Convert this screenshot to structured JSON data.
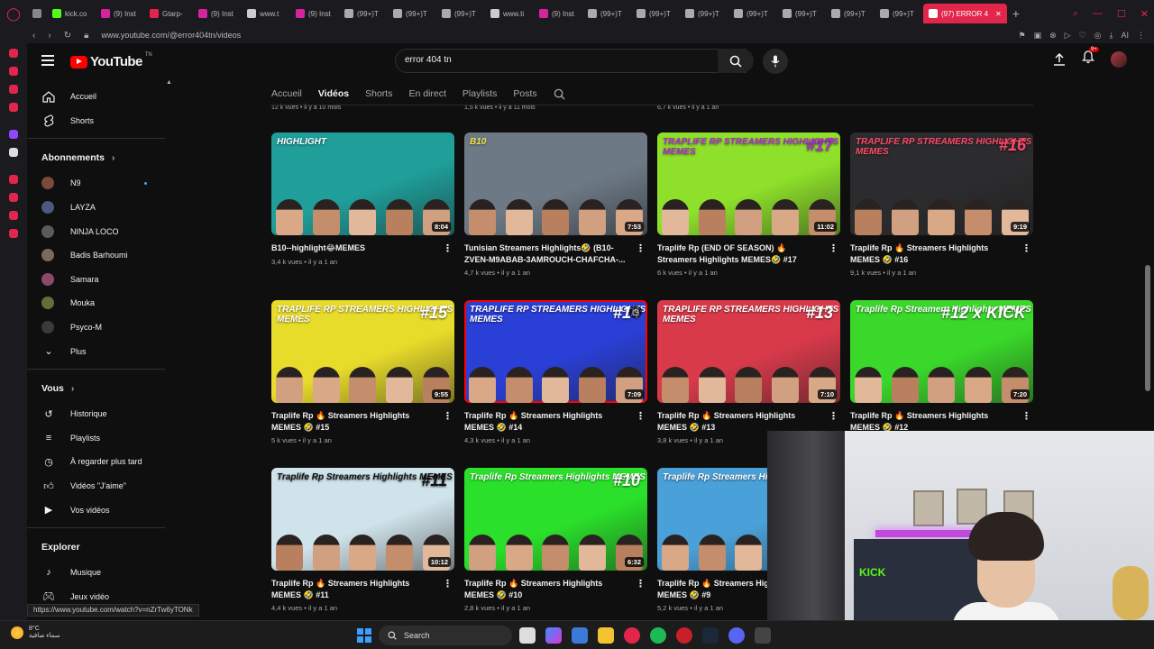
{
  "browser": {
    "tabs": [
      {
        "label": "",
        "color": "#888888"
      },
      {
        "label": "kick.co",
        "color": "#53fc18"
      },
      {
        "label": "(9) Inst",
        "color": "#d6249f"
      },
      {
        "label": "Gtarp-",
        "color": "#e2264b"
      },
      {
        "label": "(9) Inst",
        "color": "#d6249f"
      },
      {
        "label": "www.t",
        "color": "#cccccc"
      },
      {
        "label": "(9) Inst",
        "color": "#d6249f"
      },
      {
        "label": "(99+)T",
        "color": "#aaaaaa"
      },
      {
        "label": "(99+)T",
        "color": "#aaaaaa"
      },
      {
        "label": "(99+)T",
        "color": "#aaaaaa"
      },
      {
        "label": "www.ti",
        "color": "#cccccc"
      },
      {
        "label": "(9) Inst",
        "color": "#d6249f"
      },
      {
        "label": "(99+)T",
        "color": "#aaaaaa"
      },
      {
        "label": "(99+)T",
        "color": "#aaaaaa"
      },
      {
        "label": "(99+)T",
        "color": "#aaaaaa"
      },
      {
        "label": "(99+)T",
        "color": "#aaaaaa"
      },
      {
        "label": "(99+)T",
        "color": "#aaaaaa"
      },
      {
        "label": "(99+)T",
        "color": "#aaaaaa"
      },
      {
        "label": "(99+)T",
        "color": "#aaaaaa"
      }
    ],
    "active_tab": "(97) ERROR 4",
    "new_tab": "+",
    "url": "www.youtube.com/@error404tn/videos",
    "ai_label": "AI"
  },
  "youtube": {
    "logo_text": "YouTube",
    "logo_sup": "TN",
    "search_value": "error 404 tn",
    "notifications_badge": "9+"
  },
  "guide": {
    "home": "Accueil",
    "shorts": "Shorts",
    "subscriptions_title": "Abonnements",
    "subscriptions": [
      {
        "label": "N9",
        "color": "#7a4a3a",
        "new": true
      },
      {
        "label": "LAYZA",
        "color": "#4a5a7a",
        "new": false
      },
      {
        "label": "NINJA LOCO",
        "color": "#5a5a5a",
        "new": false
      },
      {
        "label": "Badis Barhoumi",
        "color": "#7a6a5a",
        "new": false
      },
      {
        "label": "Samara",
        "color": "#8a4a6a",
        "new": false
      },
      {
        "label": "Mouka",
        "color": "#6a6a3a",
        "new": false
      },
      {
        "label": "Psyco-M",
        "color": "#3a3a3a",
        "new": false
      }
    ],
    "more": "Plus",
    "you_title": "Vous",
    "you_items": [
      "Historique",
      "Playlists",
      "À regarder plus tard",
      "Vidéos \"J'aime\"",
      "Vos vidéos"
    ],
    "explore_title": "Explorer",
    "explore_items": [
      "Musique",
      "Jeux vidéo"
    ]
  },
  "channel_tabs": [
    "Accueil",
    "Vidéos",
    "Shorts",
    "En direct",
    "Playlists",
    "Posts"
  ],
  "previous_row_meta": [
    "12 k vues • il y a 10 mois",
    "1,5 k vues • il y a 11 mois",
    "6,7 k vues • il y a 1 an"
  ],
  "videos": [
    {
      "title": "B10--highlight😂MEMES",
      "meta": "3,4 k vues • il y a 1 an",
      "duration": "8:04",
      "thumb_text": "HIGHLIGHT",
      "thumb_big": "",
      "bg": "#1f9e9a",
      "accent": "#ffffff"
    },
    {
      "title": "Tunisian Streamers Highlights🤣 (B10-ZVEN-M9ABAB-3AMROUCH-CHAFCHA-...",
      "meta": "4,7 k vues • il y a 1 an",
      "duration": "7:53",
      "thumb_text": "B10",
      "thumb_big": "",
      "bg": "#6d7a86",
      "accent": "#f3e24a"
    },
    {
      "title": "Traplife Rp (END OF SEASON) 🔥 Streamers Highlights MEMES🤣 #17",
      "meta": "6 k vues • il y a 1 an",
      "duration": "11:02",
      "thumb_text": "TRAPLIFE RP STREAMERS HIGHLIGHTS MEMES",
      "thumb_big": "#17",
      "bg": "#8ee02a",
      "accent": "#b02ad6"
    },
    {
      "title": "Traplife Rp 🔥 Streamers Highlights MEMES 🤣 #16",
      "meta": "9,1 k vues • il y a 1 an",
      "duration": "9:19",
      "thumb_text": "TRAPLIFE RP STREAMERS HIGHLIGHTS MEMES",
      "thumb_big": "#16",
      "bg": "#2c2c2e",
      "accent": "#ff4a6a"
    },
    {
      "title": "Traplife Rp 🔥 Streamers Highlights MEMES 🤣 #15",
      "meta": "5 k vues • il y a 1 an",
      "duration": "9:55",
      "thumb_text": "TRAPLIFE RP STREAMERS HIGHLIGHTS MEMES",
      "thumb_big": "#15",
      "bg": "#e8dc2a",
      "accent": "#ffffff"
    },
    {
      "title": "Traplife Rp 🔥 Streamers Highlights MEMES 🤣 #14",
      "meta": "4,3 k vues • il y a 1 an",
      "duration": "7:09",
      "thumb_text": "TRAPLIFE RP STREAMERS HIGHLIGHTS MEMES",
      "thumb_big": "#14",
      "bg": "#2a3fd6",
      "accent": "#ffffff"
    },
    {
      "title": "Traplife Rp 🔥 Streamers Highlights MEMES 🤣 #13",
      "meta": "3,8 k vues • il y a 1 an",
      "duration": "7:10",
      "thumb_text": "TRAPLIFE RP STREAMERS HIGHLIGHTS MEMES",
      "thumb_big": "#13",
      "bg": "#d83a4a",
      "accent": "#ffffff"
    },
    {
      "title": "Traplife Rp 🔥 Streamers Highlights MEMES 🤣 #12",
      "meta": "",
      "duration": "7:20",
      "thumb_text": "Traplife Rp Streamers Highlights MEMES",
      "thumb_big": "#12 x KICK",
      "bg": "#3ad82a",
      "accent": "#ffffff"
    },
    {
      "title": "Traplife Rp 🔥 Streamers Highlights MEMES 🤣 #11",
      "meta": "4,4 k vues • il y a 1 an",
      "duration": "10:12",
      "thumb_text": "Traplife Rp Streamers Highlights MEMES",
      "thumb_big": "#11",
      "bg": "#cfe3ea",
      "accent": "#111111"
    },
    {
      "title": "Traplife Rp 🔥 Streamers Highlights MEMES 🤣 #10",
      "meta": "2,8 k vues • il y a 1 an",
      "duration": "6:32",
      "thumb_text": "Traplife Rp Streamers Highlights MEMES",
      "thumb_big": "#10",
      "bg": "#2ae02a",
      "accent": "#ffffff"
    },
    {
      "title": "Traplife Rp 🔥 Streamers Highlights MEMES 🤣 #9",
      "meta": "5,2 k vues • il y a 1 an",
      "duration": "",
      "thumb_text": "Traplife Rp Streamers Highli",
      "thumb_big": "",
      "bg": "#4aa0d8",
      "accent": "#ffffff"
    }
  ],
  "status_link": "https://www.youtube.com/watch?v=nZrTw6yTONk",
  "taskbar": {
    "temperature": "8°C",
    "weather_text": "سماء صافية",
    "search": "Search"
  },
  "webcam": {
    "kick_text": "KICK"
  }
}
